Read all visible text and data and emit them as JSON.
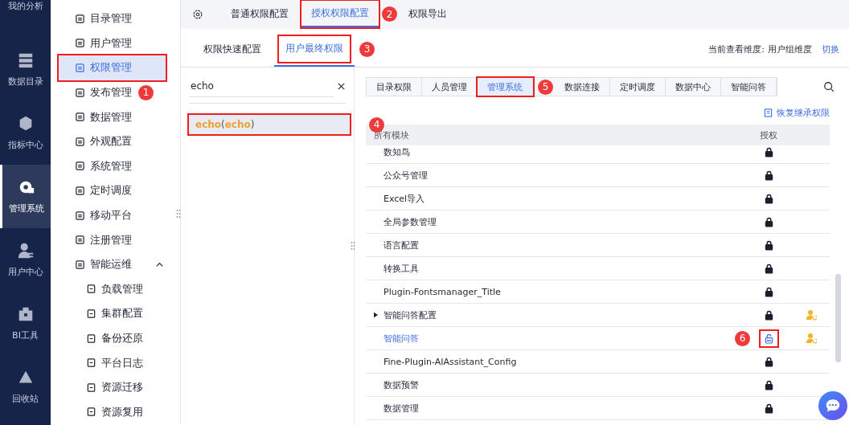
{
  "nav": [
    {
      "label": "我的分析",
      "selected": false
    },
    {
      "label": "数据目录",
      "selected": false
    },
    {
      "label": "指标中心",
      "selected": false
    },
    {
      "label": "管理系统",
      "selected": true
    },
    {
      "label": "用户中心",
      "selected": false
    },
    {
      "label": "BI工具",
      "selected": false
    },
    {
      "label": "回收站",
      "selected": false
    }
  ],
  "menu": [
    {
      "label": "目录管理",
      "selected": false
    },
    {
      "label": "用户管理",
      "selected": false
    },
    {
      "label": "权限管理",
      "selected": true,
      "boxed": true
    },
    {
      "label": "发布管理",
      "selected": false,
      "callout": "1"
    },
    {
      "label": "数据管理",
      "selected": false
    },
    {
      "label": "外观配置",
      "selected": false
    },
    {
      "label": "系统管理",
      "selected": false
    },
    {
      "label": "定时调度",
      "selected": false
    },
    {
      "label": "移动平台",
      "selected": false
    },
    {
      "label": "注册管理",
      "selected": false
    },
    {
      "label": "智能运维",
      "selected": false,
      "expanded": true,
      "children": [
        {
          "label": "负载管理",
          "selected": false
        },
        {
          "label": "集群配置",
          "selected": false
        },
        {
          "label": "备份还原",
          "selected": false
        },
        {
          "label": "平台日志",
          "selected": false
        },
        {
          "label": "资源迁移",
          "selected": false
        },
        {
          "label": "资源复用",
          "selected": false
        }
      ]
    }
  ],
  "top_tabs": [
    {
      "label": "普通权限配置",
      "selected": false
    },
    {
      "label": "授权权限配置",
      "selected": true,
      "boxed": true,
      "callout": "2"
    },
    {
      "label": "权限导出",
      "selected": false
    }
  ],
  "sub_tabs": [
    {
      "label": "权限快速配置",
      "selected": false
    },
    {
      "label": "用户最终权限",
      "selected": true,
      "boxed": true,
      "callout": "3"
    }
  ],
  "dimension": {
    "label": "当前查看维度:",
    "value": "用户组维度",
    "action": "切换"
  },
  "search": {
    "value": "echo"
  },
  "users": [
    {
      "name": "echo",
      "open_paren": "(",
      "account": "echo",
      "close_paren": ")",
      "selected": true,
      "boxed": true,
      "callout": "4"
    }
  ],
  "module_tabs": [
    {
      "label": "目录权限",
      "selected": false
    },
    {
      "label": "人员管理",
      "selected": false
    },
    {
      "label": "管理系统",
      "selected": true,
      "boxed": true,
      "callout": "5"
    },
    {
      "label": "数据连接",
      "selected": false
    },
    {
      "label": "定时调度",
      "selected": false
    },
    {
      "label": "数据中心",
      "selected": false
    },
    {
      "label": "智能问答",
      "selected": false
    }
  ],
  "restore": "恢复继承权限",
  "table": {
    "columns": [
      "所有模块",
      "授权"
    ],
    "rows": [
      {
        "name": "数知鸟",
        "locked": true,
        "expandable": false,
        "inherit": false
      },
      {
        "name": "公众号管理",
        "locked": true,
        "expandable": false,
        "inherit": false
      },
      {
        "name": "Excel导入",
        "locked": true,
        "expandable": false,
        "inherit": false
      },
      {
        "name": "全局参数管理",
        "locked": true,
        "expandable": false,
        "inherit": false
      },
      {
        "name": "语言配置",
        "locked": true,
        "expandable": false,
        "inherit": false
      },
      {
        "name": "转换工具",
        "locked": true,
        "expandable": false,
        "inherit": false
      },
      {
        "name": "Plugin-Fontsmanager_Title",
        "locked": true,
        "expandable": false,
        "inherit": false
      },
      {
        "name": "智能问答配置",
        "locked": true,
        "expandable": true,
        "expanded": false,
        "inherit": true
      },
      {
        "name": "智能问答",
        "locked": false,
        "expandable": false,
        "inherit": true,
        "boxed": true,
        "callout": "6"
      },
      {
        "name": "Fine-Plugin-AIAssistant_Config",
        "locked": true,
        "expandable": false,
        "inherit": false
      },
      {
        "name": "数据预警",
        "locked": true,
        "expandable": false,
        "inherit": false
      },
      {
        "name": "数据管理",
        "locked": true,
        "expandable": false,
        "inherit": false
      }
    ]
  }
}
